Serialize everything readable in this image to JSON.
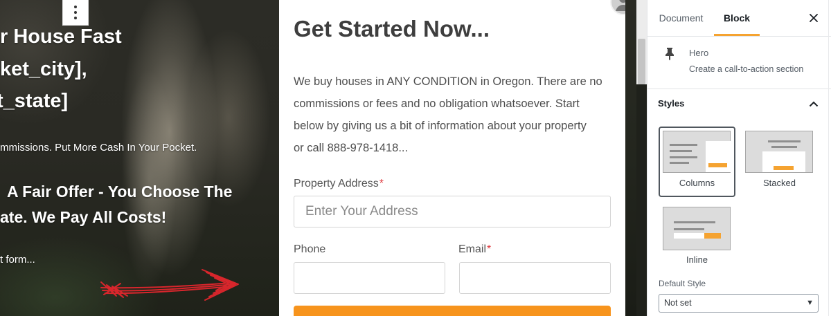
{
  "hero": {
    "headline_lines": [
      "r House Fast",
      "ket_city],",
      "t_state]"
    ],
    "subline": "mmissions. Put More Cash In Your Pocket.",
    "offer_lines": [
      "A Fair Offer - You Choose The",
      "ate. We Pay All Costs!"
    ],
    "cta_text": "t form...",
    "menu_icon": "more-vertical-icon",
    "annotation_icon": "red-arrow"
  },
  "editor": {
    "avatar_icon": "avatar-icon"
  },
  "form": {
    "heading": "Get Started Now...",
    "intro_lines": [
      "We buy houses in ANY CONDITION in Oregon. There are no",
      "commissions or fees and no obligation whatsoever. Start",
      "below by giving us a bit of information about your property",
      "or call 888-978-1418..."
    ],
    "address_label": "Property Address",
    "required_mark": "*",
    "address_placeholder": "Enter Your Address",
    "phone_label": "Phone",
    "email_label": "Email"
  },
  "sidebar": {
    "tabs": [
      {
        "label": "Document",
        "active": false
      },
      {
        "label": "Block",
        "active": true
      }
    ],
    "close_icon": "close-icon",
    "block": {
      "icon": "pin-icon",
      "name": "Hero",
      "description": "Create a call-to-action section"
    },
    "styles": {
      "title": "Styles",
      "toggle_icon": "chevron-up-icon",
      "options": [
        {
          "label": "Columns",
          "selected": true
        },
        {
          "label": "Stacked",
          "selected": false
        },
        {
          "label": "Inline",
          "selected": false
        }
      ]
    },
    "default_style": {
      "label": "Default Style",
      "value": "Not set",
      "arrow_icon": "chevron-down-icon"
    }
  },
  "colors": {
    "accent": "#f5a331",
    "button": "#f7941d",
    "arrow": "#d8262c",
    "required": "#e0393e"
  }
}
